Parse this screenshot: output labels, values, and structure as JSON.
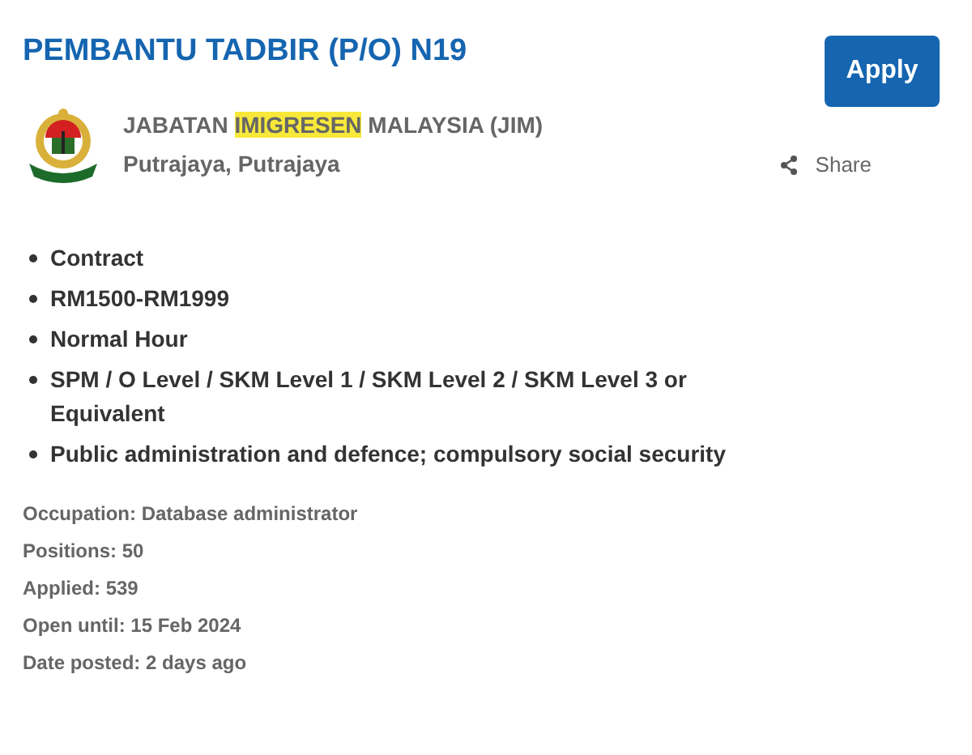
{
  "job": {
    "title": "PEMBANTU TADBIR (P/O) N19",
    "employer": [
      {
        "text": "JABATAN ",
        "highlighted": false
      },
      {
        "text": "IMIGRESEN",
        "highlighted": true
      },
      {
        "text": " MALAYSIA (JIM)",
        "highlighted": false
      }
    ],
    "location": "Putrajaya, Putrajaya"
  },
  "apply_button": "Apply",
  "share_button": "Share",
  "features": [
    "Contract",
    "RM1500-RM1999",
    "Normal Hour",
    "SPM / O Level / SKM Level 1 / SKM Level 2 / SKM Level 3 or Equivalent",
    "Public administration and defence; compulsory social security"
  ],
  "details": [
    "Occupation: Database administrator",
    "Positions: 50",
    "Applied: 539",
    "Open until: 15 Feb 2024",
    "Date posted: 2 days ago"
  ]
}
